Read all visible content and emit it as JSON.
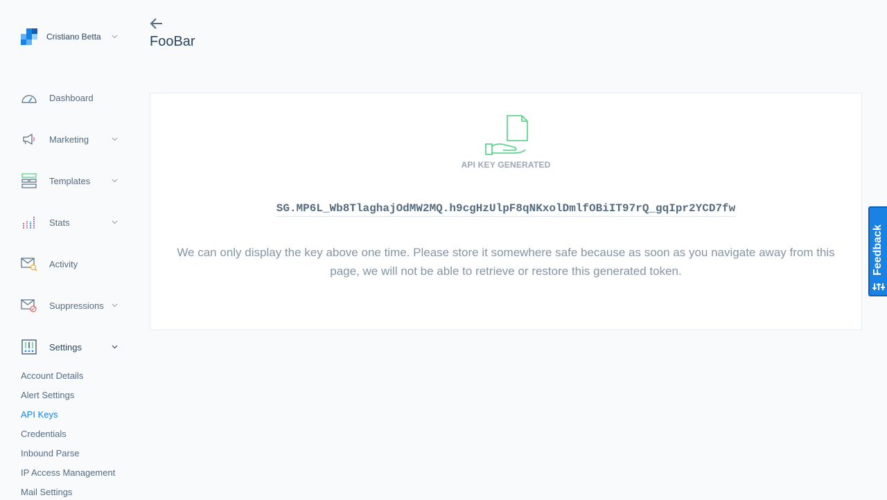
{
  "account": {
    "name": "Cristiano Betta"
  },
  "nav": {
    "dashboard": "Dashboard",
    "marketing": "Marketing",
    "templates": "Templates",
    "stats": "Stats",
    "activity": "Activity",
    "suppressions": "Suppressions",
    "settings": "Settings"
  },
  "settings_sub": [
    "Account Details",
    "Alert Settings",
    "API Keys",
    "Credentials",
    "Inbound Parse",
    "IP Access Management",
    "Mail Settings"
  ],
  "page": {
    "title": "FooBar"
  },
  "card": {
    "heading": "API KEY GENERATED",
    "api_key": "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",
    "notice": "We can only display the key above one time. Please store it somewhere safe because as soon as you navigate away from this page, we will not be able to retrieve or restore this generated token."
  },
  "feedback": {
    "label": "Feedback"
  },
  "colors": {
    "brand_blue": "#1a82e2",
    "success_green": "#4cd083",
    "text_dark": "#294661"
  }
}
